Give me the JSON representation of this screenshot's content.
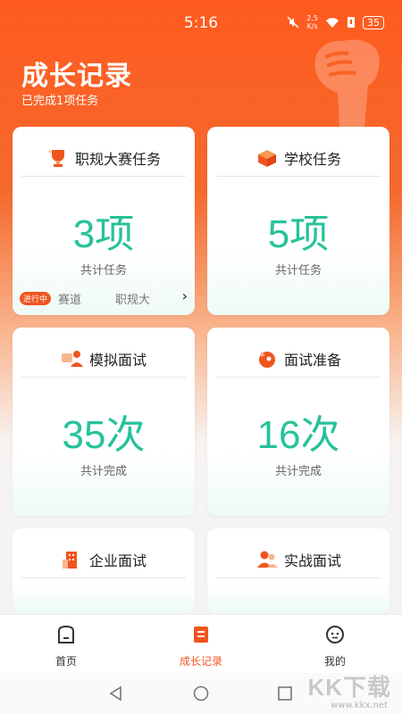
{
  "status": {
    "time": "5:16",
    "speed_top": "2.5",
    "speed_bottom": "K/s",
    "battery": "35"
  },
  "header": {
    "title": "成长记录",
    "subtitle": "已完成1项任务"
  },
  "cards": [
    {
      "label": "职规大赛任务",
      "value": "3项",
      "caption": "共计任务",
      "icon": "trophy-icon",
      "ticker": {
        "badge": "进行中",
        "item1": "赛道",
        "item2": "职规大"
      }
    },
    {
      "label": "学校任务",
      "value": "5项",
      "caption": "共计任务",
      "icon": "school-box-icon"
    },
    {
      "label": "模拟面试",
      "value": "35次",
      "caption": "共计完成",
      "icon": "interview-icon"
    },
    {
      "label": "面试准备",
      "value": "16次",
      "caption": "共计完成",
      "icon": "rocket-icon"
    },
    {
      "label": "企业面试",
      "value": "",
      "caption": "",
      "icon": "building-icon"
    },
    {
      "label": "实战面试",
      "value": "",
      "caption": "",
      "icon": "people-icon"
    }
  ],
  "tabs": [
    {
      "label": "首页",
      "icon": "home-icon"
    },
    {
      "label": "成长记录",
      "icon": "record-icon",
      "active": true
    },
    {
      "label": "我的",
      "icon": "profile-icon"
    }
  ],
  "watermark": {
    "text": "KK下载",
    "url": "www.kkx.net"
  },
  "colors": {
    "accent": "#f0551f",
    "value_green": "#27c29a"
  }
}
